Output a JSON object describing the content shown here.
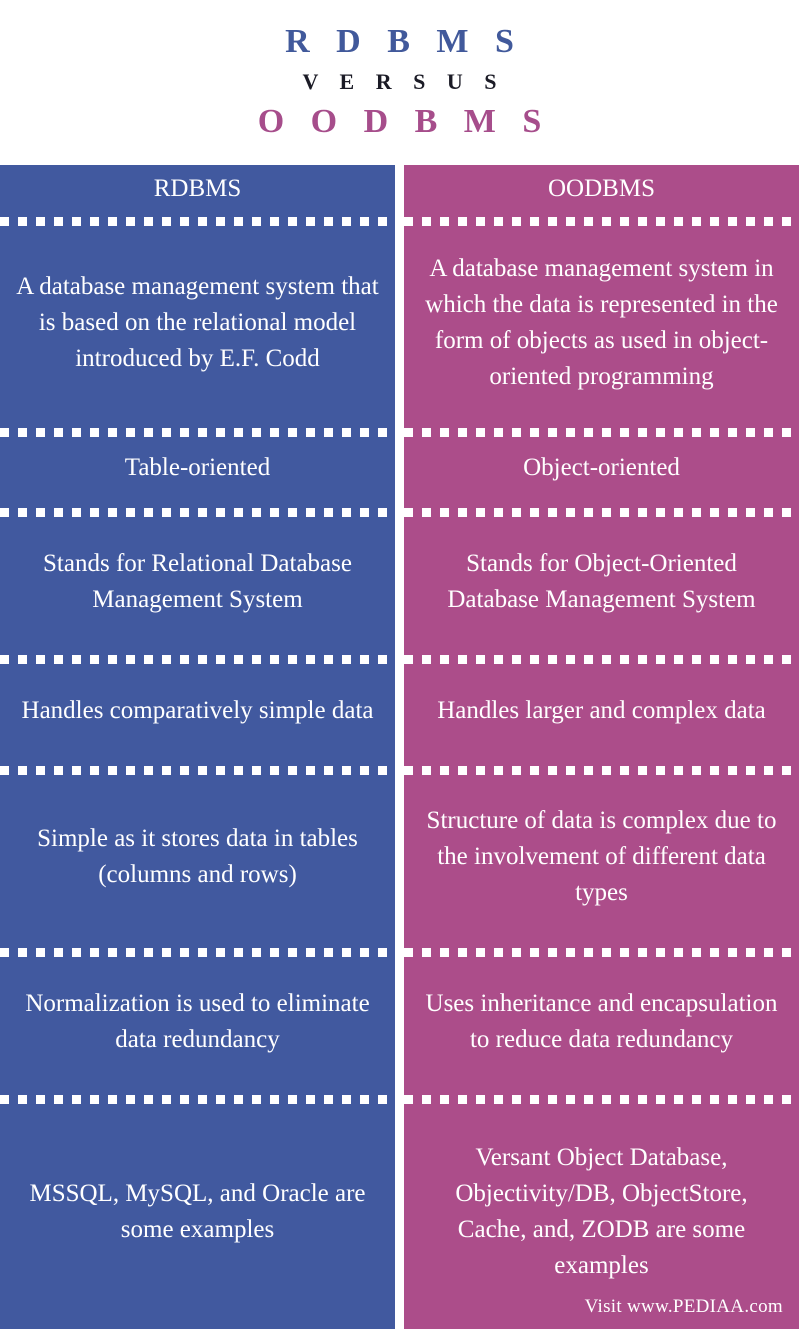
{
  "title": {
    "left_term": "R D B M S",
    "connector": "V E R S U S",
    "right_term": "O O D B M S",
    "left_color": "#41599B",
    "connector_color": "#1b1b26",
    "right_color": "#A64D8B"
  },
  "table": {
    "left_header": "RDBMS",
    "right_header": "OODBMS",
    "left_color": "#41599F",
    "right_color": "#AC4D8A",
    "separator_color": "#ffffff",
    "rows": [
      {
        "left": "A database management system that is based on the relational model introduced by E.F. Codd",
        "right": "A  database management system in which the data is represented in the form of objects as used in object-oriented programming"
      },
      {
        "left": "Table-oriented",
        "right": "Object-oriented"
      },
      {
        "left": "Stands for Relational Database Management System",
        "right": "Stands for Object-Oriented Database Management System"
      },
      {
        "left": "Handles comparatively simple data",
        "right": "Handles larger and complex data"
      },
      {
        "left": "Simple as it stores data in tables (columns and rows)",
        "right": "Structure of data is complex due to the involvement of different data types"
      },
      {
        "left": "Normalization is used to eliminate data redundancy",
        "right": "Uses inheritance and encapsulation to reduce data redundancy"
      },
      {
        "left": "MSSQL, MySQL, and Oracle are some examples",
        "right": "Versant Object Database, Objectivity/DB, ObjectStore, Cache, and, ZODB are some examples"
      }
    ]
  },
  "footer": {
    "credit": "Visit www.PEDIAA.com"
  }
}
